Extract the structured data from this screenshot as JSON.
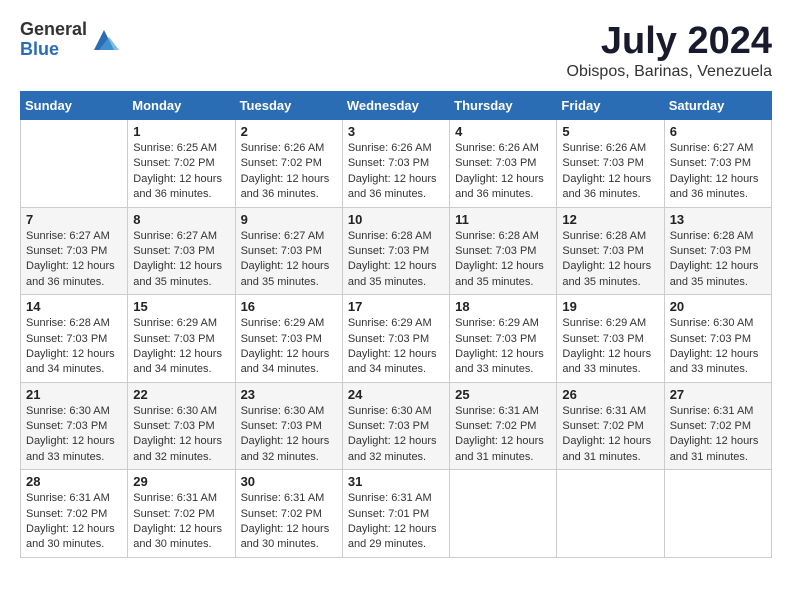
{
  "header": {
    "logo_general": "General",
    "logo_blue": "Blue",
    "main_title": "July 2024",
    "subtitle": "Obispos, Barinas, Venezuela"
  },
  "calendar": {
    "days_of_week": [
      "Sunday",
      "Monday",
      "Tuesday",
      "Wednesday",
      "Thursday",
      "Friday",
      "Saturday"
    ],
    "weeks": [
      [
        {
          "day": "",
          "info": ""
        },
        {
          "day": "1",
          "info": "Sunrise: 6:25 AM\nSunset: 7:02 PM\nDaylight: 12 hours\nand 36 minutes."
        },
        {
          "day": "2",
          "info": "Sunrise: 6:26 AM\nSunset: 7:02 PM\nDaylight: 12 hours\nand 36 minutes."
        },
        {
          "day": "3",
          "info": "Sunrise: 6:26 AM\nSunset: 7:03 PM\nDaylight: 12 hours\nand 36 minutes."
        },
        {
          "day": "4",
          "info": "Sunrise: 6:26 AM\nSunset: 7:03 PM\nDaylight: 12 hours\nand 36 minutes."
        },
        {
          "day": "5",
          "info": "Sunrise: 6:26 AM\nSunset: 7:03 PM\nDaylight: 12 hours\nand 36 minutes."
        },
        {
          "day": "6",
          "info": "Sunrise: 6:27 AM\nSunset: 7:03 PM\nDaylight: 12 hours\nand 36 minutes."
        }
      ],
      [
        {
          "day": "7",
          "info": "Sunrise: 6:27 AM\nSunset: 7:03 PM\nDaylight: 12 hours\nand 36 minutes."
        },
        {
          "day": "8",
          "info": "Sunrise: 6:27 AM\nSunset: 7:03 PM\nDaylight: 12 hours\nand 35 minutes."
        },
        {
          "day": "9",
          "info": "Sunrise: 6:27 AM\nSunset: 7:03 PM\nDaylight: 12 hours\nand 35 minutes."
        },
        {
          "day": "10",
          "info": "Sunrise: 6:28 AM\nSunset: 7:03 PM\nDaylight: 12 hours\nand 35 minutes."
        },
        {
          "day": "11",
          "info": "Sunrise: 6:28 AM\nSunset: 7:03 PM\nDaylight: 12 hours\nand 35 minutes."
        },
        {
          "day": "12",
          "info": "Sunrise: 6:28 AM\nSunset: 7:03 PM\nDaylight: 12 hours\nand 35 minutes."
        },
        {
          "day": "13",
          "info": "Sunrise: 6:28 AM\nSunset: 7:03 PM\nDaylight: 12 hours\nand 35 minutes."
        }
      ],
      [
        {
          "day": "14",
          "info": "Sunrise: 6:28 AM\nSunset: 7:03 PM\nDaylight: 12 hours\nand 34 minutes."
        },
        {
          "day": "15",
          "info": "Sunrise: 6:29 AM\nSunset: 7:03 PM\nDaylight: 12 hours\nand 34 minutes."
        },
        {
          "day": "16",
          "info": "Sunrise: 6:29 AM\nSunset: 7:03 PM\nDaylight: 12 hours\nand 34 minutes."
        },
        {
          "day": "17",
          "info": "Sunrise: 6:29 AM\nSunset: 7:03 PM\nDaylight: 12 hours\nand 34 minutes."
        },
        {
          "day": "18",
          "info": "Sunrise: 6:29 AM\nSunset: 7:03 PM\nDaylight: 12 hours\nand 33 minutes."
        },
        {
          "day": "19",
          "info": "Sunrise: 6:29 AM\nSunset: 7:03 PM\nDaylight: 12 hours\nand 33 minutes."
        },
        {
          "day": "20",
          "info": "Sunrise: 6:30 AM\nSunset: 7:03 PM\nDaylight: 12 hours\nand 33 minutes."
        }
      ],
      [
        {
          "day": "21",
          "info": "Sunrise: 6:30 AM\nSunset: 7:03 PM\nDaylight: 12 hours\nand 33 minutes."
        },
        {
          "day": "22",
          "info": "Sunrise: 6:30 AM\nSunset: 7:03 PM\nDaylight: 12 hours\nand 32 minutes."
        },
        {
          "day": "23",
          "info": "Sunrise: 6:30 AM\nSunset: 7:03 PM\nDaylight: 12 hours\nand 32 minutes."
        },
        {
          "day": "24",
          "info": "Sunrise: 6:30 AM\nSunset: 7:03 PM\nDaylight: 12 hours\nand 32 minutes."
        },
        {
          "day": "25",
          "info": "Sunrise: 6:31 AM\nSunset: 7:02 PM\nDaylight: 12 hours\nand 31 minutes."
        },
        {
          "day": "26",
          "info": "Sunrise: 6:31 AM\nSunset: 7:02 PM\nDaylight: 12 hours\nand 31 minutes."
        },
        {
          "day": "27",
          "info": "Sunrise: 6:31 AM\nSunset: 7:02 PM\nDaylight: 12 hours\nand 31 minutes."
        }
      ],
      [
        {
          "day": "28",
          "info": "Sunrise: 6:31 AM\nSunset: 7:02 PM\nDaylight: 12 hours\nand 30 minutes."
        },
        {
          "day": "29",
          "info": "Sunrise: 6:31 AM\nSunset: 7:02 PM\nDaylight: 12 hours\nand 30 minutes."
        },
        {
          "day": "30",
          "info": "Sunrise: 6:31 AM\nSunset: 7:02 PM\nDaylight: 12 hours\nand 30 minutes."
        },
        {
          "day": "31",
          "info": "Sunrise: 6:31 AM\nSunset: 7:01 PM\nDaylight: 12 hours\nand 29 minutes."
        },
        {
          "day": "",
          "info": ""
        },
        {
          "day": "",
          "info": ""
        },
        {
          "day": "",
          "info": ""
        }
      ]
    ]
  }
}
